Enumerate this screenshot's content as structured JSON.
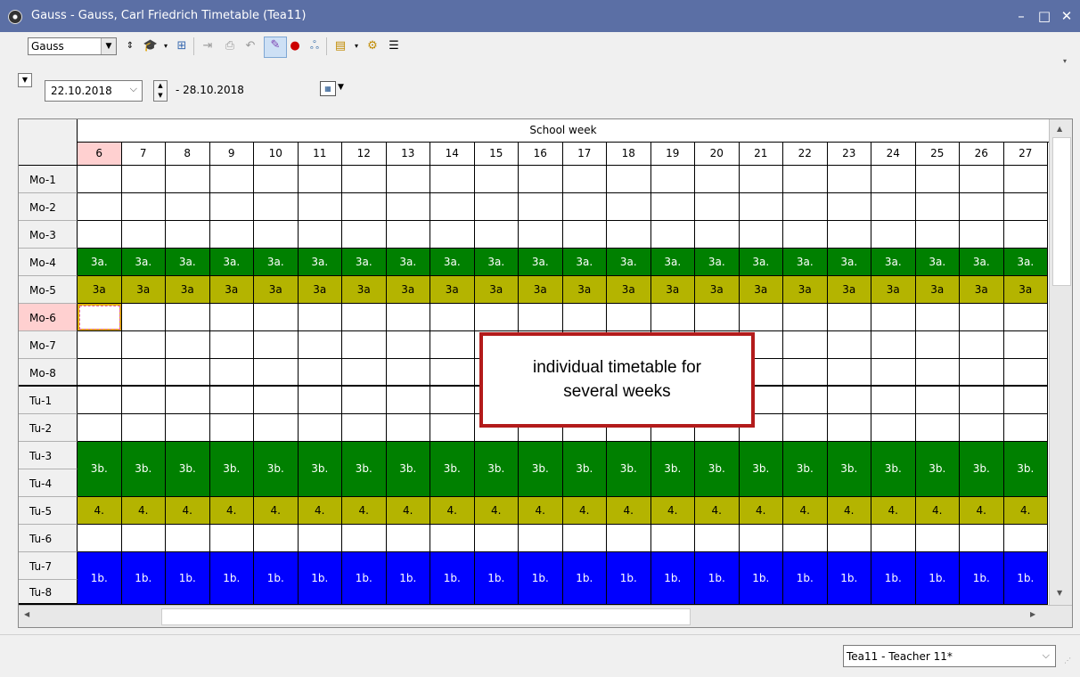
{
  "window": {
    "title": "Gauss - Gauss, Carl Friedrich  Timetable  (Tea11)",
    "minimize": "–",
    "maximize": "□",
    "close": "✕"
  },
  "toolbar": {
    "element_select": "Gauss",
    "icons": [
      "spin-arrows-icon",
      "mortarboard-icon",
      "grid-icon",
      "export-icon",
      "print-icon",
      "undo-icon",
      "color-brush-icon",
      "magnifier-pin-icon",
      "network-icon",
      "settings-doc-icon",
      "gear-icon",
      "list-filter-icon"
    ]
  },
  "dates": {
    "start": "22.10.2018",
    "end": "- 28.10.2018"
  },
  "grid": {
    "header_title": "School week",
    "weeks": [
      "6",
      "7",
      "8",
      "9",
      "10",
      "11",
      "12",
      "13",
      "14",
      "15",
      "16",
      "17",
      "18",
      "19",
      "20",
      "21",
      "22",
      "23",
      "24",
      "25",
      "26",
      "27"
    ],
    "highlight_week": "6",
    "periods": [
      "Mo-1",
      "Mo-2",
      "Mo-3",
      "Mo-4",
      "Mo-5",
      "Mo-6",
      "Mo-7",
      "Mo-8",
      "Tu-1",
      "Tu-2",
      "Tu-3",
      "Tu-4",
      "Tu-5",
      "Tu-6",
      "Tu-7",
      "Tu-8"
    ],
    "highlight_period": "Mo-6",
    "lessons": [
      {
        "periods": [
          "Mo-4"
        ],
        "label": "3a.",
        "color": "#008000",
        "text_color": "#ffffff"
      },
      {
        "periods": [
          "Mo-5"
        ],
        "label": "3a",
        "color": "#b4b400",
        "text_color": "#000000"
      },
      {
        "periods": [
          "Tu-3",
          "Tu-4"
        ],
        "label": "3b.",
        "color": "#008000",
        "text_color": "#ffffff"
      },
      {
        "periods": [
          "Tu-5"
        ],
        "label": "4.",
        "color": "#b4b400",
        "text_color": "#000000"
      },
      {
        "periods": [
          "Tu-7",
          "Tu-8"
        ],
        "label": "1b.",
        "color": "#0000ff",
        "text_color": "#ffffff"
      }
    ]
  },
  "callout": {
    "line1": "individual timetable for",
    "line2": "several weeks",
    "border_color": "#b31b1b"
  },
  "status": {
    "selection": "Tea11 - Teacher 11*"
  },
  "colors": {
    "titlebar": "#5b6fa5",
    "highlight": "#ffd0d0",
    "selected_cell_border": "#e0b000"
  }
}
